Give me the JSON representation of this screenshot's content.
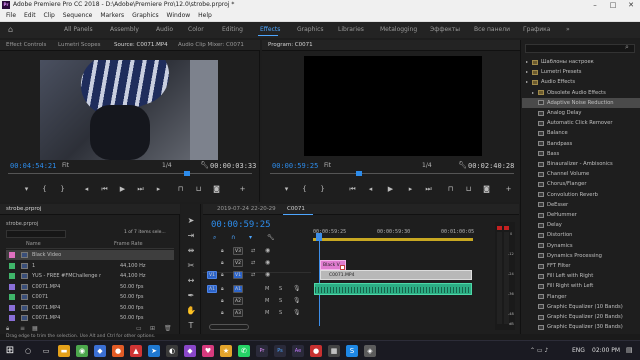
{
  "window": {
    "title": "Adobe Premiere Pro CC 2018 - D:\\Adobe\\Premiere Pro\\12.0\\strobe.prproj *",
    "app_logo": "Pr",
    "controls": [
      "–",
      "□",
      "✕"
    ]
  },
  "menu": [
    "File",
    "Edit",
    "Clip",
    "Sequence",
    "Markers",
    "Graphics",
    "Window",
    "Help"
  ],
  "workspaces": {
    "home_icon": "home-icon",
    "tabs": [
      "All Panels",
      "Assembly",
      "Audio",
      "Color",
      "Editing",
      "Effects",
      "Graphics",
      "Libraries",
      "Metalogging",
      "Эффекты",
      "Все панели",
      "Графика"
    ],
    "active": "Effects",
    "overflow": "»"
  },
  "source_panel": {
    "tabs": [
      "Effect Controls",
      "Lumetri Scopes",
      "Source: C0071.MP4",
      "Audio Clip Mixer: C0071"
    ],
    "active_tab": "Source: C0071.MP4",
    "timecode_current": "00:04:54:21",
    "fit": "Fit",
    "ratio": "1/4",
    "timecode_duration": "00:00:03:33"
  },
  "program_panel": {
    "tabs": [
      "Program: C0071"
    ],
    "timecode_current": "00:00:59:25",
    "fit": "Fit",
    "ratio": "1/4",
    "timecode_duration": "00:02:40:28"
  },
  "effects_panel": {
    "items": [
      {
        "label": "Шаблоны настроек",
        "indent": 1,
        "type": "folder"
      },
      {
        "label": "Lumetri Presets",
        "indent": 1,
        "type": "folder"
      },
      {
        "label": "Audio Effects",
        "indent": 1,
        "type": "folder"
      },
      {
        "label": "Obsolete Audio Effects",
        "indent": 2,
        "type": "folder"
      },
      {
        "label": "Adaptive Noise Reduction",
        "indent": 2,
        "type": "fx",
        "selected": true
      },
      {
        "label": "Analog Delay",
        "indent": 2,
        "type": "fx"
      },
      {
        "label": "Automatic Click Remover",
        "indent": 2,
        "type": "fx"
      },
      {
        "label": "Balance",
        "indent": 2,
        "type": "fx"
      },
      {
        "label": "Bandpass",
        "indent": 2,
        "type": "fx"
      },
      {
        "label": "Bass",
        "indent": 2,
        "type": "fx"
      },
      {
        "label": "Binauralizer - Ambisonics",
        "indent": 2,
        "type": "fx"
      },
      {
        "label": "Channel Volume",
        "indent": 2,
        "type": "fx"
      },
      {
        "label": "Chorus/Flanger",
        "indent": 2,
        "type": "fx"
      },
      {
        "label": "Convolution Reverb",
        "indent": 2,
        "type": "fx"
      },
      {
        "label": "DeEsser",
        "indent": 2,
        "type": "fx"
      },
      {
        "label": "DeHummer",
        "indent": 2,
        "type": "fx"
      },
      {
        "label": "Delay",
        "indent": 2,
        "type": "fx"
      },
      {
        "label": "Distortion",
        "indent": 2,
        "type": "fx"
      },
      {
        "label": "Dynamics",
        "indent": 2,
        "type": "fx"
      },
      {
        "label": "Dynamics Processing",
        "indent": 2,
        "type": "fx"
      },
      {
        "label": "FFT Filter",
        "indent": 2,
        "type": "fx"
      },
      {
        "label": "Fill Left with Right",
        "indent": 2,
        "type": "fx"
      },
      {
        "label": "Fill Right with Left",
        "indent": 2,
        "type": "fx"
      },
      {
        "label": "Flanger",
        "indent": 2,
        "type": "fx"
      },
      {
        "label": "Graphic Equalizer (10 Bands)",
        "indent": 2,
        "type": "fx"
      },
      {
        "label": "Graphic Equalizer (20 Bands)",
        "indent": 2,
        "type": "fx"
      },
      {
        "label": "Graphic Equalizer (30 Bands)",
        "indent": 2,
        "type": "fx"
      },
      {
        "label": "GuitarSuite",
        "indent": 2,
        "type": "fx"
      },
      {
        "label": "Hard Limiter",
        "indent": 2,
        "type": "fx"
      }
    ]
  },
  "project_panel": {
    "tab": "strobe.prproj",
    "path": "strobe.prproj",
    "items_count": "1 of 7 items sele...",
    "columns": [
      "Name",
      "Frame Rate"
    ],
    "rows": [
      {
        "name": "Black Video",
        "rate": "",
        "color": "#e070c0",
        "selected": true
      },
      {
        "name": "1",
        "rate": "44,100 Hz",
        "color": "#3fb56a"
      },
      {
        "name": "YUS - FREE #FMChallenge r",
        "rate": "44,100 Hz",
        "color": "#3fb56a"
      },
      {
        "name": "C0071.MP4",
        "rate": "50.00 fps",
        "color": "#8a6fd8"
      },
      {
        "name": "C0071",
        "rate": "50.00 fps",
        "color": "#3fb56a"
      },
      {
        "name": "C0071.MP4",
        "rate": "50.00 fps",
        "color": "#8a6fd8"
      },
      {
        "name": "C0071.MP4",
        "rate": "50.00 fps",
        "color": "#8a6fd8"
      }
    ]
  },
  "timeline": {
    "tab_date": "2019-07-24 22-20-29",
    "tab_seq": "C0071",
    "timecode": "00:00:59:25",
    "ruler": [
      "00:00:59:25",
      "00:00:59:30",
      "00:01:00:05"
    ],
    "tracks": [
      {
        "name": "V3",
        "src": ""
      },
      {
        "name": "V2",
        "src": ""
      },
      {
        "name": "V1",
        "src": "V1"
      },
      {
        "name": "A1",
        "src": "A1"
      },
      {
        "name": "A2",
        "src": ""
      },
      {
        "name": "A3",
        "src": ""
      }
    ],
    "clips": {
      "black_video": "Black V",
      "video": "C0071.MP4"
    },
    "meter_labels": [
      "0",
      "-12",
      "-24",
      "-36",
      "-48",
      "dB"
    ]
  },
  "status_bar": "Drag edge to trim the selection. Use Alt and Ctrl for other options.",
  "taskbar": {
    "lang": "ENG",
    "time": "02:00 PM"
  },
  "colors": {
    "accent": "#2d8ceb",
    "clip_pink": "#e07cd0",
    "clip_audio": "#2cae84",
    "playhead": "#3d8ee8"
  }
}
